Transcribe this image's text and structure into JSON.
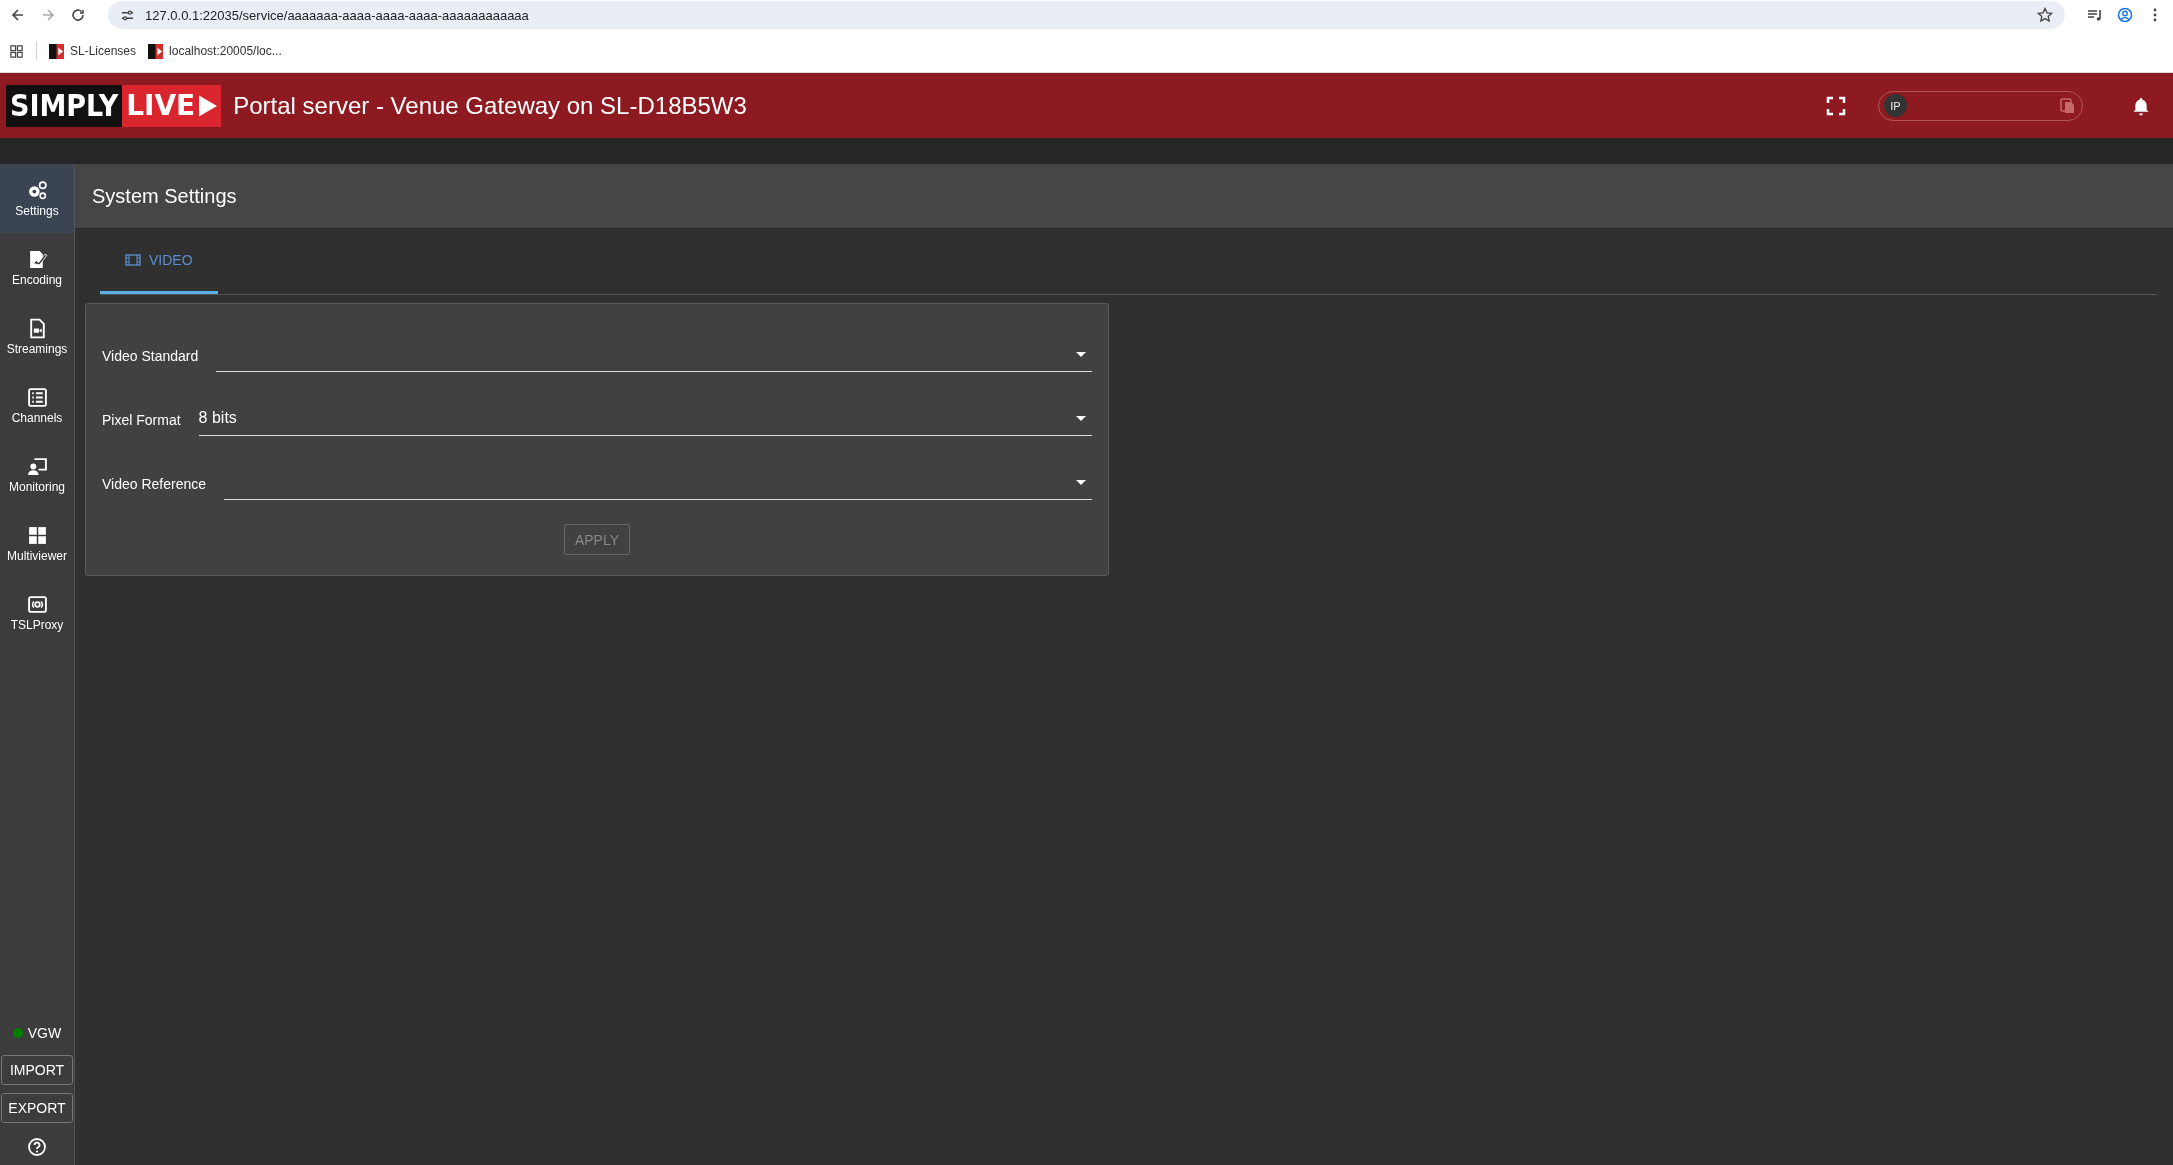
{
  "browser": {
    "url": "127.0.0.1:22035/service/aaaaaaa-aaaa-aaaa-aaaa-aaaaaaaaaaaa",
    "bookmarks": [
      "SL-Licenses",
      "localhost:20005/loc..."
    ]
  },
  "header": {
    "logo": [
      "SIMPLY",
      "LIVE"
    ],
    "title": "Portal server - Venue Gateway on SL-D18B5W3",
    "ip_badge": "IP"
  },
  "sidebar": {
    "items": [
      {
        "label": "Settings",
        "selected": true
      },
      {
        "label": "Encoding",
        "selected": false
      },
      {
        "label": "Streamings",
        "selected": false
      },
      {
        "label": "Channels",
        "selected": false
      },
      {
        "label": "Monitoring",
        "selected": false
      },
      {
        "label": "Multiviewer",
        "selected": false
      },
      {
        "label": "TSLProxy",
        "selected": false
      }
    ],
    "status": {
      "label": "VGW",
      "color": "#008000"
    },
    "buttons": [
      "IMPORT",
      "EXPORT"
    ]
  },
  "page_title": "System Settings",
  "tabs": [
    {
      "label": "VIDEO",
      "selected": true
    }
  ],
  "form": {
    "fields": [
      {
        "label": "Video Standard"
      },
      {
        "label": "Pixel Format",
        "value": "8 bits"
      },
      {
        "label": "Video Reference"
      }
    ],
    "apply": {
      "label": "APPLY",
      "disabled": true
    }
  }
}
